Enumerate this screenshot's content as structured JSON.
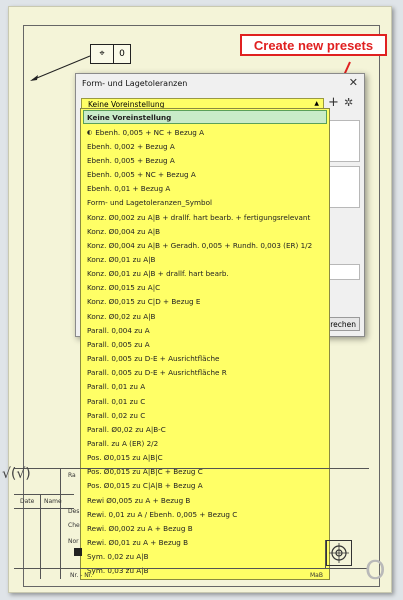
{
  "callout": {
    "text": "Create new presets",
    "color": "#e02020"
  },
  "frame_box": {
    "symbol": "⌖",
    "value": "0"
  },
  "dialog": {
    "title": "Form- und Lagetoleranzen",
    "close": "✕",
    "combo_value": "Keine Voreinstellung",
    "add_icon": "+",
    "settings_icon": "gear-icon",
    "cancel_partial": "brechen"
  },
  "dropdown": {
    "background": "#ffff66",
    "items": [
      {
        "label": "Keine Voreinstellung",
        "selected": true
      },
      {
        "label": "Ebenh. 0,005 + NC + Bezug A",
        "marker": "◐"
      },
      {
        "label": "Ebenh. 0,002 + Bezug A"
      },
      {
        "label": "Ebenh. 0,005 + Bezug A"
      },
      {
        "label": "Ebenh. 0,005 + NC + Bezug A"
      },
      {
        "label": "Ebenh. 0,01 + Bezug A"
      },
      {
        "label": "Form- und Lagetoleranzen_Symbol"
      },
      {
        "label": "Konz. Ø0,002 zu A|B + drallf. hart bearb. + fertigungsrelevant"
      },
      {
        "label": "Konz. Ø0,004 zu A|B"
      },
      {
        "label": "Konz. Ø0,004 zu A|B + Geradh. 0,005 + Rundh. 0,003 (ER) 1/2"
      },
      {
        "label": "Konz. Ø0,01 zu A|B"
      },
      {
        "label": "Konz. Ø0,01 zu A|B + drallf. hart bearb."
      },
      {
        "label": "Konz. Ø0,015 zu A|C"
      },
      {
        "label": "Konz. Ø0,015 zu C|D + Bezug E"
      },
      {
        "label": "Konz. Ø0,02 zu A|B"
      },
      {
        "label": "Parall. 0,004 zu A"
      },
      {
        "label": "Parall. 0,005 zu A"
      },
      {
        "label": "Parall. 0,005 zu D-E + Ausrichtfläche"
      },
      {
        "label": "Parall. 0,005 zu D-E + Ausrichtfläche R"
      },
      {
        "label": "Parall. 0,01 zu A"
      },
      {
        "label": "Parall. 0,01 zu C"
      },
      {
        "label": "Parall. 0,02 zu C"
      },
      {
        "label": "Parall. Ø0,02 zu A|B-C"
      },
      {
        "label": "Parall. zu A (ER) 2/2"
      },
      {
        "label": "Pos. Ø0,015 zu A|B|C"
      },
      {
        "label": "Pos. Ø0,015 zu A|B|C + Bezug C"
      },
      {
        "label": "Pos. Ø0,015 zu C|A|B + Bezug A"
      },
      {
        "label": "Rewi Ø0,005 zu A + Bezug B"
      },
      {
        "label": "Rewi. 0,01 zu A / Ebenh. 0,005 + Bezug C"
      },
      {
        "label": "Rewi. Ø0,002 zu A + Bezug B"
      },
      {
        "label": "Rewi. Ø0,01 zu A + Bezug B"
      },
      {
        "label": "Sym. 0,02 zu A|B"
      },
      {
        "label": "Sym. 0,03 zu A|B"
      }
    ]
  },
  "title_block": {
    "date": "Date",
    "name": "Name",
    "row1": "Des",
    "row2": "Che",
    "row3": "Nor",
    "col_ra": "Ra",
    "footer_left": "Nr. - Nr.",
    "footer_right": "MaB",
    "check": "√(√)"
  }
}
